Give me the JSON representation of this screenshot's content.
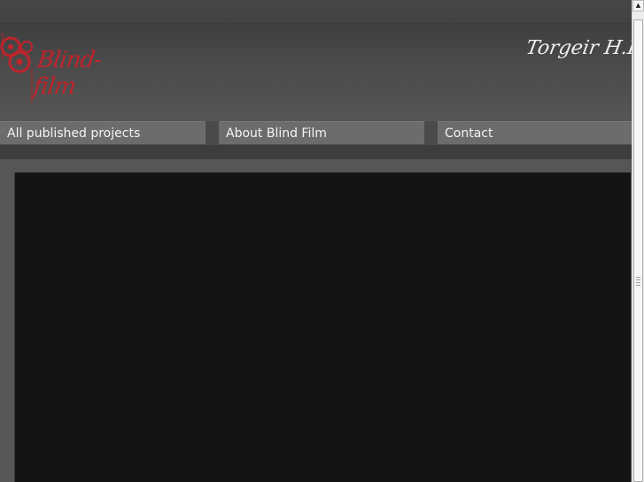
{
  "header": {
    "logo_text": "Blind-film",
    "signature_text": "Torgeir H.Riesti"
  },
  "nav": {
    "items": [
      {
        "label": "All published projects"
      },
      {
        "label": "About Blind Film"
      },
      {
        "label": "Contact"
      }
    ]
  },
  "scrollbar": {
    "up_arrow_icon": "up-arrow-icon"
  },
  "colors": {
    "logo_red": "#c0242c",
    "background": "#4e4e4e",
    "nav_background": "#6c6c6c",
    "video_panel": "#141414"
  }
}
